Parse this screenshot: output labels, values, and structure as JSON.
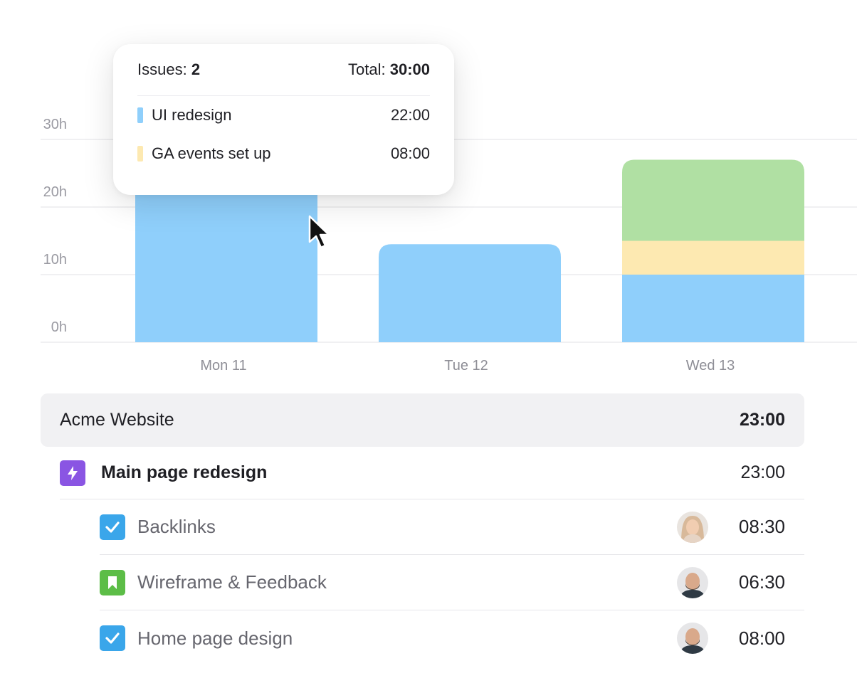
{
  "colors": {
    "ui_redesign": "#8fcffb",
    "ga_events": "#fde9b1",
    "other": "#b0e0a3",
    "task_icon_purple": "#8a55e3",
    "check_blue": "#3aa6ea",
    "bookmark_green": "#5cbd47",
    "avatar_female": "#d8b99a",
    "avatar_male": "#5a4a40"
  },
  "chart_data": {
    "type": "bar",
    "stacked": true,
    "categories": [
      "Mon 11",
      "Tue 12",
      "Wed 13"
    ],
    "y_ticks": [
      "0h",
      "10h",
      "20h",
      "30h"
    ],
    "ylim": [
      0,
      30
    ],
    "series": [
      {
        "name": "UI redesign",
        "color": "#8fcffb",
        "values": [
          22,
          14.5,
          10
        ]
      },
      {
        "name": "GA events set up",
        "color": "#fde9b1",
        "values": [
          8,
          0,
          5
        ]
      },
      {
        "color": "#b0e0a3",
        "values": [
          0,
          0,
          12
        ]
      }
    ],
    "grid": true
  },
  "tooltip": {
    "issues_label": "Issues: ",
    "issues_count": "2",
    "total_label": "Total: ",
    "total_value": "30:00",
    "rows": [
      {
        "label": "UI redesign",
        "value": "22:00"
      },
      {
        "label": "GA events set up",
        "value": "08:00"
      }
    ]
  },
  "project": {
    "name": "Acme Website",
    "time": "23:00"
  },
  "task": {
    "name": "Main page redesign",
    "time": "23:00",
    "icon": "lightning-icon"
  },
  "subtasks": [
    {
      "name": "Backlinks",
      "time": "08:30",
      "icon": "checkbox-icon",
      "avatar": "female-avatar"
    },
    {
      "name": "Wireframe & Feedback",
      "time": "06:30",
      "icon": "bookmark-icon",
      "avatar": "male-avatar"
    },
    {
      "name": "Home page design",
      "time": "08:00",
      "icon": "checkbox-icon",
      "avatar": "male-avatar"
    }
  ]
}
